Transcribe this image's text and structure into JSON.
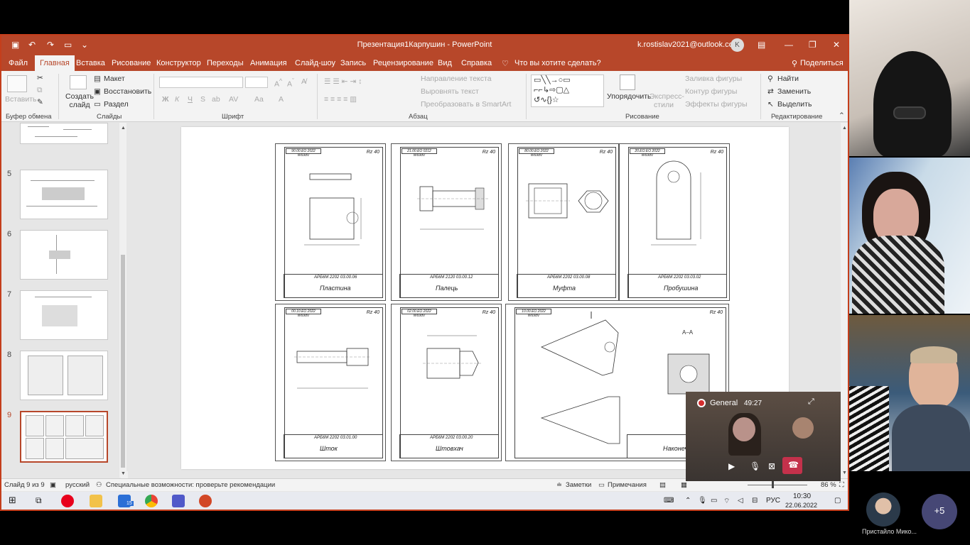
{
  "window": {
    "title": "Презентация1Карпушин  -  PowerPoint",
    "account": "k.rostislav2021@outlook.com",
    "avatar_initial": "K"
  },
  "tabs": [
    "Файл",
    "Главная",
    "Вставка",
    "Рисование",
    "Конструктор",
    "Переходы",
    "Анимация",
    "Слайд-шоу",
    "Запись",
    "Рецензирование",
    "Вид",
    "Справка"
  ],
  "tell_me": "Что вы хотите сделать?",
  "share_label": "Поделиться",
  "ribbon": {
    "paste": "Вставить",
    "create_slide": "Создать слайд",
    "layout": "Макет",
    "reset": "Восстановить",
    "section": "Раздел",
    "text_direction": "Направление текста",
    "align_text": "Выровнять текст",
    "smartart": "Преобразовать в SmartArt",
    "arrange": "Упорядочить",
    "express_styles": "Экспресс-стили",
    "shape_fill": "Заливка фигуры",
    "shape_outline": "Контур фигуры",
    "shape_effects": "Эффекты фигуры",
    "find": "Найти",
    "replace": "Заменить",
    "select": "Выделить",
    "font_buttons": [
      "Ж",
      "К",
      "Ч",
      "S",
      "ab",
      "AV",
      "Aa",
      "A"
    ],
    "groups": [
      "Буфер обмена",
      "Слайды",
      "Шрифт",
      "Абзац",
      "Рисование",
      "Редактирование"
    ]
  },
  "thumbnails": [
    "5",
    "6",
    "7",
    "8",
    "9"
  ],
  "sheets": [
    {
      "code": "АРБ6М 2202 03.00.06",
      "name": "Пластина",
      "corner": "90.00.ЕО 2022 W69dV"
    },
    {
      "code": "АРБ6М 2120 03.00.12",
      "name": "Палець",
      "corner": "21.00.ЕО 0212 W69dV"
    },
    {
      "code": "АРБ6М 2202 03.00.08",
      "name": "Муфта",
      "corner": "80.00.ЕО 2022 W69dV"
    },
    {
      "code": "АРБ6М 2202 03.03.02",
      "name": "Пробушина",
      "corner": "20.ЕО.ЕО 2022 W69dV"
    },
    {
      "code": "АРБ6М 2202 03.01.00",
      "name": "Шток",
      "corner": "00.10.ЕО 2022 W69dV"
    },
    {
      "code": "АРБ6М 2202 03.00.20",
      "name": "Штовхач",
      "corner": "02.00.ЕО 2022 W69dV"
    },
    {
      "code": "",
      "name": "Наконеч",
      "corner": "10.00.ЕО 2022 W69dV"
    }
  ],
  "rz_label": "Rz 40",
  "status": {
    "slide": "Слайд 9 из 9",
    "lang": "русский",
    "accessibility": "Специальные возможности: проверьте рекомендации",
    "notes": "Заметки",
    "comments": "Примечания",
    "zoom": "86 %"
  },
  "taskbar": {
    "lang": "РУС",
    "time": "10:30",
    "date": "22.06.2022",
    "badge": "15"
  },
  "mini_call": {
    "channel": "General",
    "timer": "49:27"
  },
  "participants": {
    "name": "Пристайло Мико...",
    "more": "+5"
  },
  "section_label": "A–A"
}
